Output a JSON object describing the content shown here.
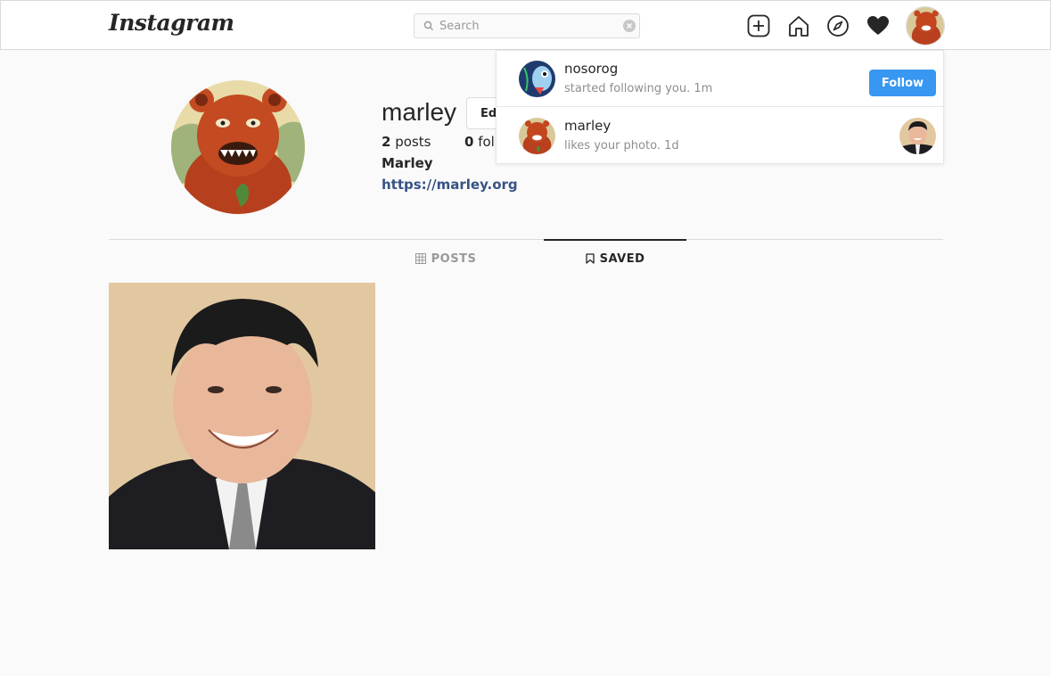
{
  "header": {
    "logo": "Instagram",
    "search_placeholder": "Search",
    "icons": [
      "new-post-icon",
      "home-icon",
      "explore-compass-icon",
      "heart-icon",
      "profile-avatar"
    ]
  },
  "profile": {
    "username": "marley",
    "edit_label": "Edi",
    "posts_count": "2",
    "posts_label": "posts",
    "followers_count": "0",
    "followers_label": "fol",
    "full_name": "Marley",
    "website": "https://marley.org"
  },
  "tabs": [
    {
      "label": "POSTS",
      "active": false,
      "icon": "grid-icon"
    },
    {
      "label": "SAVED",
      "active": true,
      "icon": "bookmark-icon"
    }
  ],
  "notifications": [
    {
      "username": "nosorog",
      "text": "started following you.",
      "time": "1m",
      "action_label": "Follow"
    },
    {
      "username": "marley",
      "text": "likes your photo.",
      "time": "1d"
    }
  ],
  "colors": {
    "accent": "#3897f0",
    "link": "#375284",
    "border": "#dbdbdb",
    "background": "#fafafa"
  }
}
